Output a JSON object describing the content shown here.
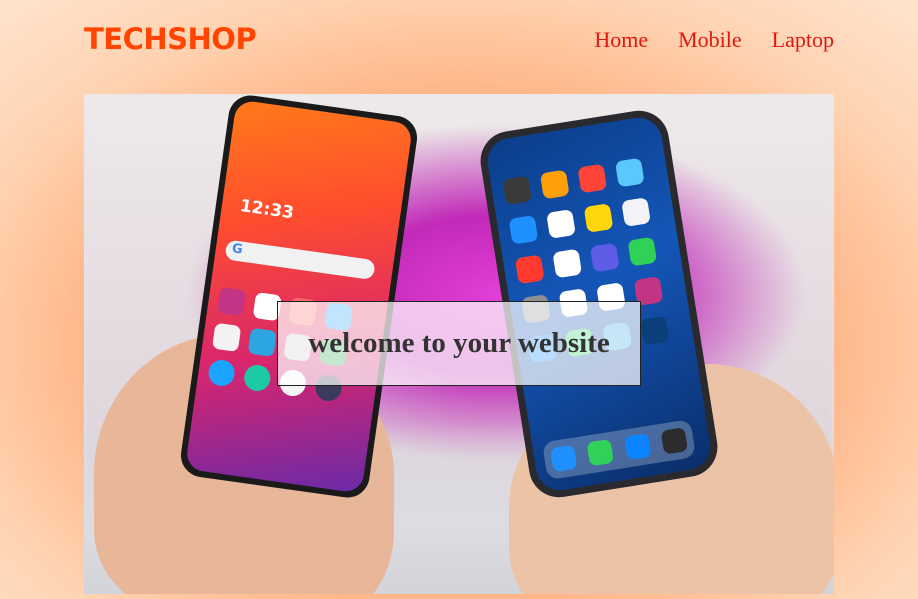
{
  "header": {
    "logo": "TECHSHOP",
    "nav": [
      "Home",
      "Mobile",
      "Laptop"
    ]
  },
  "hero": {
    "image": "two-smartphones-in-hands",
    "heading": "welcome to your website",
    "left_phone_clock": "12:33"
  },
  "colors": {
    "logo": "#ff4500",
    "nav_link": "#e0180f",
    "background_center": "#ff8a50",
    "background_edge": "#ffe0c8",
    "overlay_bg": "rgba(255,255,255,0.72)",
    "heading_text": "#333333"
  }
}
